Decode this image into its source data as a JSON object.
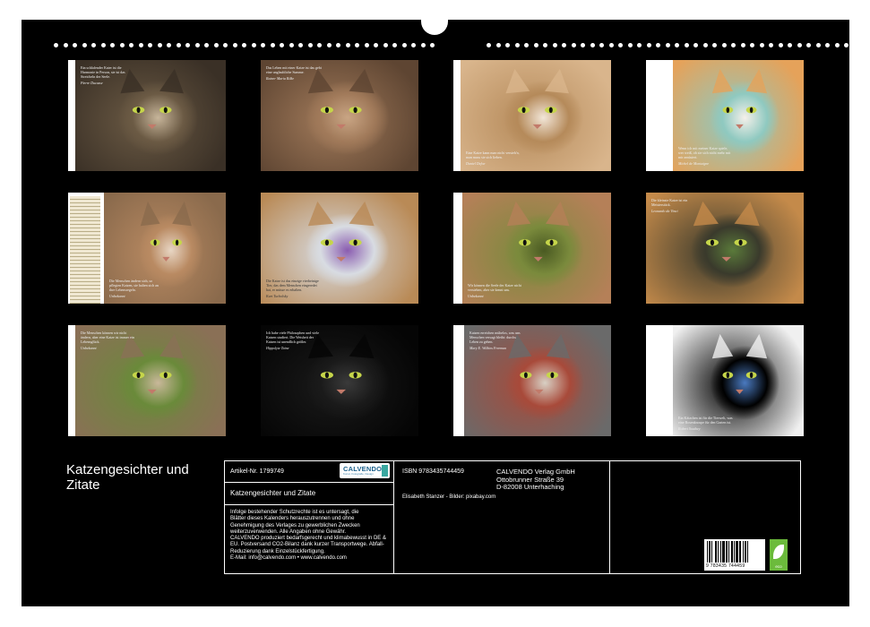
{
  "calendar": {
    "title": "Katzengesichter und Zitate",
    "colors": {
      "background": "#000000",
      "paper": "#ffffff",
      "text": "#ffffff"
    }
  },
  "thumbnails": [
    {
      "id": "t1",
      "quote": "Ein schlafender Kater ist die Harmonie in Person, sie ist das Streicheln der Seele.",
      "author": "Pierre Ducasse",
      "colors": [
        "#6b5a44",
        "#3a3026",
        "#c7b59a"
      ]
    },
    {
      "id": "t2",
      "quote": "Das Leben mit einer Katze ist das gebt eine unglaubliche Summe.",
      "author": "Rainer Maria Rilke",
      "colors": [
        "#a17a5a",
        "#5e4532",
        "#c9a584"
      ]
    },
    {
      "id": "t3",
      "quote": "Eine Katze kann man nicht versteh'n, man muss sie sich lieben.",
      "author": "Daniel Defoe",
      "colors": [
        "#b58a5a",
        "#d9b58c",
        "#f2e6d8"
      ]
    },
    {
      "id": "t4",
      "quote": "Wenn ich mit meiner Katze spiele, wer weiß, ob sie sich nicht mehr mit mir amüsiert.",
      "author": "Michel de Montaigne",
      "colors": [
        "#8fc9c0",
        "#e5a25a",
        "#f5f0ea"
      ]
    },
    {
      "id": "t5",
      "quote": "Die Menschen ändern sich, so pflegten Katzen, sie halten sich an ihre Lebensregeln.",
      "author": "Unbekannt",
      "colors": [
        "#b98a62",
        "#8a6a4c",
        "#e8d6c4"
      ]
    },
    {
      "id": "t6",
      "quote": "Die Katze ist das einzige vierbeinige Tier, das dem Menschen eingeredet hat, er müsse es erhalten.",
      "author": "Kurt Tucholsky",
      "colors": [
        "#d8dce2",
        "#b98a56",
        "#8a5cb0"
      ]
    },
    {
      "id": "t7",
      "quote": "Wir können die Seele der Katze nicht verstehen, aber sie kennt uns.",
      "author": "Unbekannt",
      "colors": [
        "#7a8a3c",
        "#b58058",
        "#4a5a22"
      ]
    },
    {
      "id": "t8",
      "quote": "Die kleinste Katze ist ein Meisterstück.",
      "author": "Leonardo da Vinci",
      "colors": [
        "#3a3a2c",
        "#c48a4a",
        "#5a7a3a"
      ]
    },
    {
      "id": "t9",
      "quote": "Die Menschen können wir nicht ändern, aber eine Katze ist immer ein Lebensglück.",
      "author": "Unbekannt",
      "colors": [
        "#6a8a3a",
        "#8a7056",
        "#c9b89a"
      ]
    },
    {
      "id": "t10",
      "quote": "Ich habe viele Philosophen und viele Katzen studiert. Die Weisheit der Katzen ist unendlich größer.",
      "author": "Hippolyte Taine",
      "colors": [
        "#1a1a1a",
        "#050505",
        "#3a3a3a"
      ]
    },
    {
      "id": "t11",
      "quote": "Katzen erreichen mühelos, was uns Menschen versagt bleibt: durchs Leben zu gehen.",
      "author": "Mary E. Wilkins Freeman",
      "colors": [
        "#a84a3a",
        "#6a6a6a",
        "#d8d0c4"
      ]
    },
    {
      "id": "t12",
      "quote": "Ein Kätzchen ist für die Tierwelt, was eine Rosenknospe für den Garten ist.",
      "author": "Robert Southey",
      "colors": [
        "#000000",
        "#f0f0f0",
        "#4a7ac0"
      ]
    }
  ],
  "info_panel": {
    "article_label": "Artikel-Nr. 1799749",
    "publisher_logo": "CALVENDO",
    "publisher_logo_sub": "Kunst, Fotografie, Design",
    "title_line": "Katzengesichter und Zitate",
    "legal_text": [
      "Infolge bestehender Schutzrechte ist es untersagt, die",
      "Blätter dieses Kalenders herauszutrennen und ohne",
      "Genehmigung des Verlages zu gewerblichen Zwecken",
      "weiterzuverwenden. Alle Angaben ohne Gewähr.",
      "CALVENDO produziert bedarfsgerecht und klimabewusst in DE &",
      "EU. Postversand CO2-Bilanz dank kurzer Transportwege. Abfall-",
      "Reduzierung dank Einzelstückfertigung.",
      "E-Mail: info@calvendo.com • www.calvendo.com"
    ],
    "isbn": "ISBN 9783435744459",
    "publisher_address": [
      "CALVENDO Verlag GmbH",
      "Ottobrunner Straße 39",
      "D-82008 Unterhaching"
    ],
    "credits": "Elisabeth Stanzer - Bilder: pixabay.com",
    "barcode_number": "9 783435 744459",
    "eco_label": "eco"
  }
}
